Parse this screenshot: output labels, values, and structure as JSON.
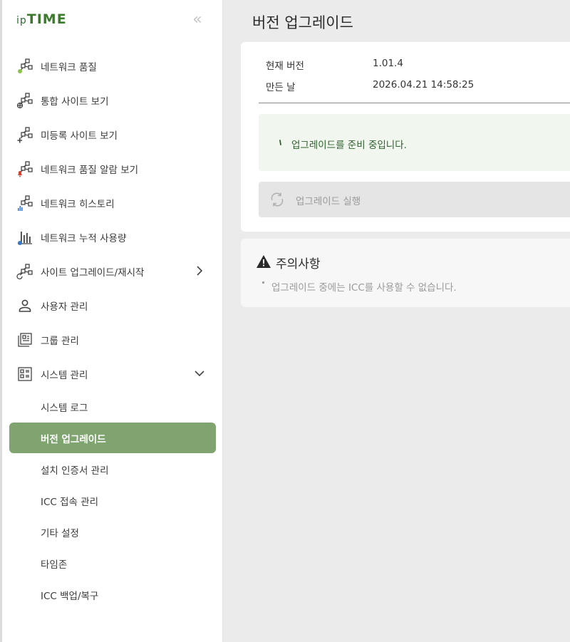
{
  "brand": {
    "ip": "ip",
    "time": "TIME"
  },
  "sidebar": {
    "collapse_glyph": "«",
    "items": [
      {
        "label": "네트워크 품질",
        "icon": "network-quality-icon"
      },
      {
        "label": "통합 사이트 보기",
        "icon": "integrated-sites-icon"
      },
      {
        "label": "미등록 사이트 보기",
        "icon": "unregistered-sites-icon"
      },
      {
        "label": "네트워크 품질 알람 보기",
        "icon": "network-alarm-icon"
      },
      {
        "label": "네트워크 히스토리",
        "icon": "network-history-icon"
      },
      {
        "label": "네트워크 누적 사용량",
        "icon": "usage-chart-icon"
      },
      {
        "label": "사이트 업그레이드/재시작",
        "icon": "site-upgrade-icon"
      },
      {
        "label": "사용자 관리",
        "icon": "user-icon"
      },
      {
        "label": "그룹 관리",
        "icon": "group-icon"
      },
      {
        "label": "시스템 관리",
        "icon": "system-icon"
      }
    ],
    "system_submenu": [
      {
        "label": "시스템 로그"
      },
      {
        "label": "버전 업그레이드"
      },
      {
        "label": "설치 인증서 관리"
      },
      {
        "label": "ICC 접속 관리"
      },
      {
        "label": "기타 설정"
      },
      {
        "label": "타임존"
      },
      {
        "label": "ICC 백업/복구"
      }
    ]
  },
  "main": {
    "title": "버전 업그레이드",
    "version_card": {
      "current_version_label": "현재 버전",
      "current_version_value": "1.01.4",
      "build_date_label": "만든 날",
      "build_date_value": "2026.04.21 14:58:25",
      "notice_text": "업그레이드를 준비 중입니다.",
      "run_button_label": "업그레이드 실행"
    },
    "caution": {
      "title": "주의사항",
      "text": "업그레이드 중에는 ICC를 사용할 수 없습니다."
    }
  },
  "colors": {
    "accent": "#7fa46f",
    "brand_green": "#3d7a2f",
    "notice_bg": "#f1f7ee",
    "alarm_red": "#d9402b"
  }
}
